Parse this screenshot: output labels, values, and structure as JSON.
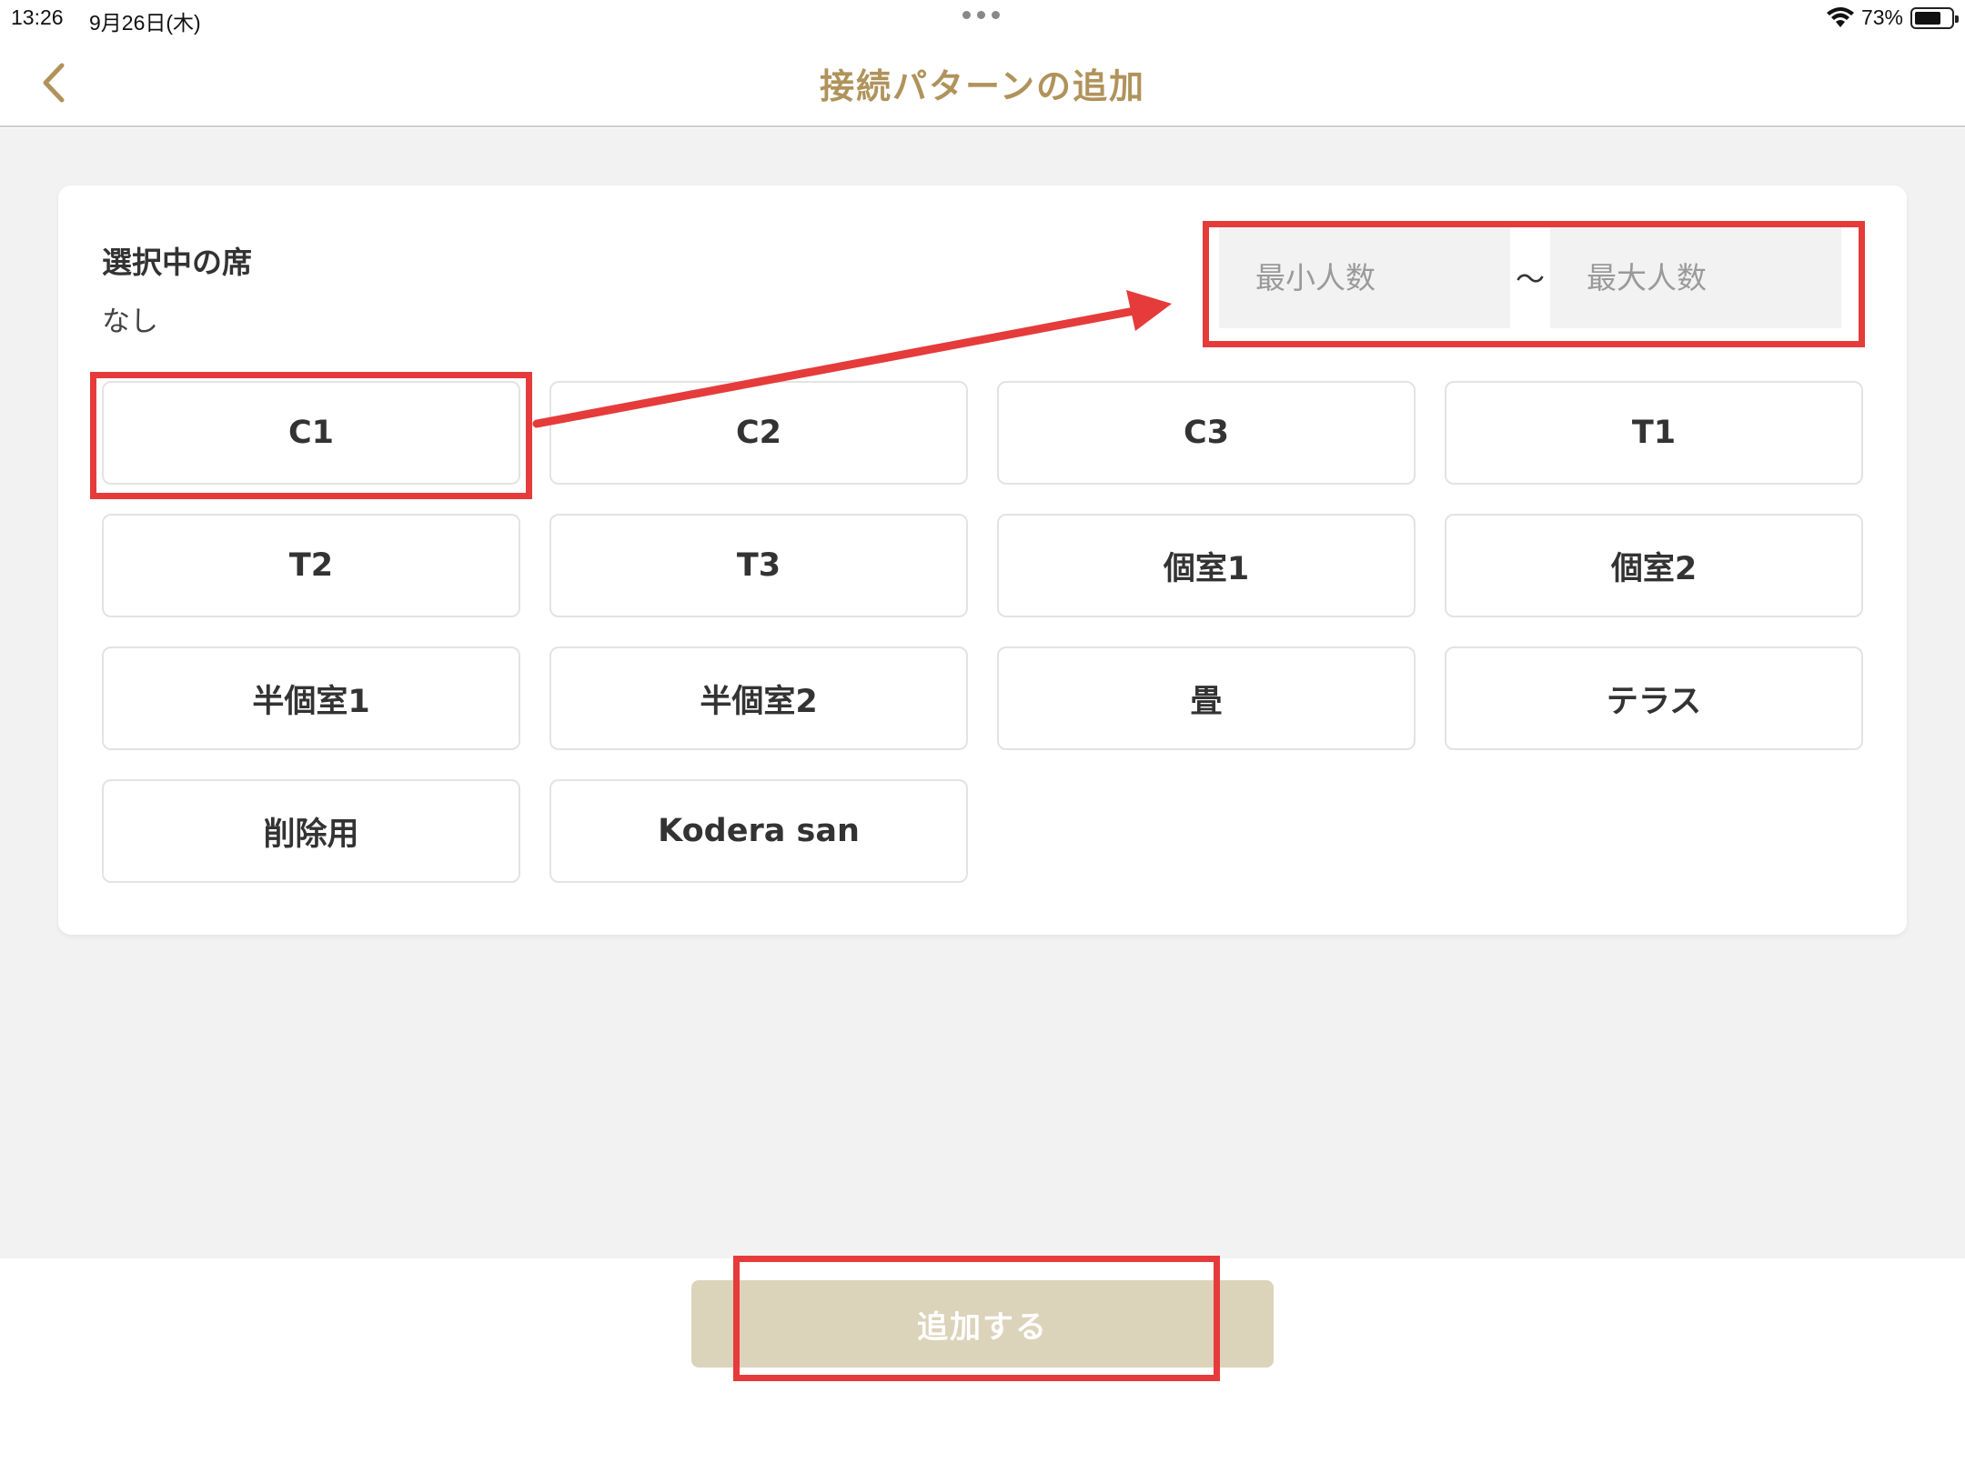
{
  "status_bar": {
    "time": "13:26",
    "date": "9月26日(木)",
    "battery": "73%",
    "battery_level": 0.73
  },
  "nav": {
    "title": "接続パターンの追加",
    "title_color": "#b0935b"
  },
  "selection": {
    "label": "選択中の席",
    "value": "なし"
  },
  "range": {
    "min_placeholder": "最小人数",
    "separator": "〜",
    "max_placeholder": "最大人数"
  },
  "seats": [
    "C1",
    "C2",
    "C3",
    "T1",
    "T2",
    "T3",
    "個室1",
    "個室2",
    "半個室1",
    "半個室2",
    "畳",
    "テラス",
    "削除用",
    "Kodera san"
  ],
  "footer": {
    "add_label": "追加する"
  },
  "colors": {
    "annotation": "#e63b3b",
    "button_disabled": "#dcd3bb"
  }
}
